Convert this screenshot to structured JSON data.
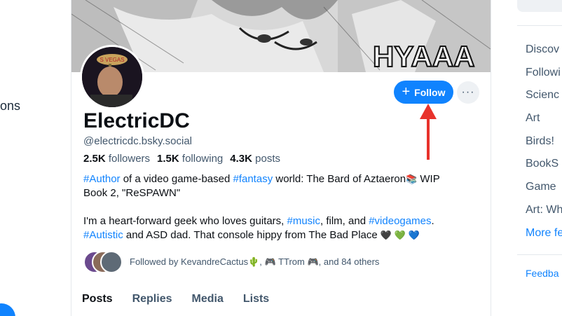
{
  "left_nav": {
    "partial_label": "ons"
  },
  "profile": {
    "display_name": "ElectricDC",
    "handle": "@electricdc.bsky.social",
    "followers_count": "2.5K",
    "followers_label": "followers",
    "following_count": "1.5K",
    "following_label": "following",
    "posts_count": "4.3K",
    "posts_label": "posts",
    "follow_label": "Follow",
    "more_label": "···",
    "bio": {
      "l1_tag1": "#Author",
      "l1_text1": " of a video game-based ",
      "l1_tag2": "#fantasy",
      "l1_text2": " world: The Bard of Aztaeron",
      "l1_emoji": "📚",
      "l1_text3": " WIP",
      "l2_text": "Book 2, \"ReSPAWN\"",
      "p2_text1": "I'm a heart-forward geek who loves guitars, ",
      "p2_tag1": "#music",
      "p2_text2": ", film, and ",
      "p2_tag2": "#videogames",
      "p2_text3": ".",
      "p2_tag3": "#Autistic",
      "p2_text4": " and ASD dad. That console hippy from The Bad Place ",
      "p2_hearts": "🖤 💚 💙"
    },
    "followed_by": {
      "prefix": "Followed by KevandreCactus",
      "emoji1": "🌵",
      "sep": ", ",
      "emoji2": "🎮",
      "name2": " TTrom ",
      "emoji3": "🎮",
      "suffix": ", and 84 others"
    }
  },
  "tabs": [
    "Posts",
    "Replies",
    "Media",
    "Lists"
  ],
  "banner": {
    "text": "HYAAA"
  },
  "right_sidebar": {
    "feeds": [
      "Discov",
      "Followi",
      "Scienc",
      "Art",
      "Birds!",
      "BookS",
      "Game",
      "Art: Wh"
    ],
    "more_label": "More fe",
    "feedback_label": "Feedba"
  },
  "colors": {
    "accent": "#1083fe",
    "arrow": "#e8322b",
    "muted": "#42576c"
  }
}
